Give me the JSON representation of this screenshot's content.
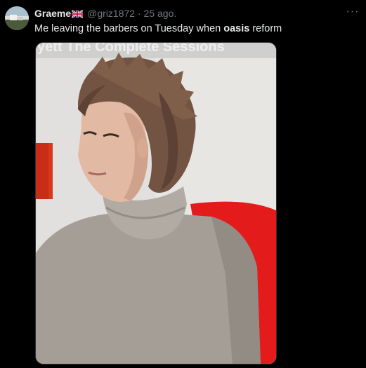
{
  "tweet": {
    "display_name": "Graeme",
    "flag_icon": "uk-flag-icon",
    "handle": "@griz1872",
    "separator": "·",
    "timestamp": "25 ago.",
    "more_icon": "more-options-icon",
    "text_before": "Me leaving the barbers on Tuesday when ",
    "text_bold": "oasis",
    "text_after": " reform",
    "media": {
      "description_icon": "photo-man-turtleneck",
      "caption_overlay": "yett   The Complete Sessions"
    }
  },
  "colors": {
    "background": "#000000",
    "primary_text": "#e7e9ea",
    "secondary_text": "#71767b",
    "sweater": "#a39d95",
    "hair": "#6b4f3f",
    "couch": "#e01a1a"
  }
}
